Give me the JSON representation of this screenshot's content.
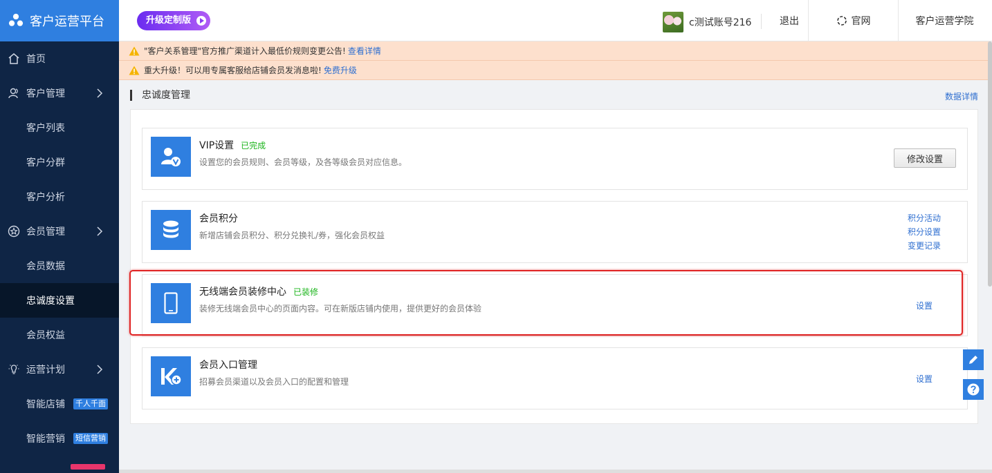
{
  "brand": {
    "title": "客户运营平台"
  },
  "sidebar": {
    "items": [
      {
        "label": "首页",
        "icon": "home-icon",
        "level": "top"
      },
      {
        "label": "客户管理",
        "icon": "users-icon",
        "level": "top",
        "expandable": true
      },
      {
        "label": "客户列表",
        "level": "sub"
      },
      {
        "label": "客户分群",
        "level": "sub"
      },
      {
        "label": "客户分析",
        "level": "sub"
      },
      {
        "label": "会员管理",
        "icon": "star-circle-icon",
        "level": "top",
        "expandable": true
      },
      {
        "label": "会员数据",
        "level": "sub"
      },
      {
        "label": "忠诚度设置",
        "level": "sub",
        "active": true
      },
      {
        "label": "会员权益",
        "level": "sub"
      },
      {
        "label": "运营计划",
        "icon": "bulb-icon",
        "level": "top",
        "expandable": true
      },
      {
        "label": "智能店铺",
        "level": "sub",
        "tag": "千人千面",
        "tag_color": "#2f7fe0"
      },
      {
        "label": "智能营销",
        "level": "sub",
        "tag": "短信营销",
        "tag_color": "#2f7fe0"
      }
    ]
  },
  "header": {
    "upgrade_label": "升级定制版",
    "account_name": "c测试账号216",
    "logout": "退出",
    "official_site": "官网",
    "academy": "客户运营学院"
  },
  "notices": [
    {
      "text": "\"客户关系管理\"官方推广渠道计入最低价规则变更公告!",
      "link": "查看详情"
    },
    {
      "text": "重大升级！可以用专属客服给店铺会员发消息啦!",
      "link": "免费升级"
    }
  ],
  "main": {
    "title": "忠诚度管理",
    "data_detail": "数据详情",
    "cards": [
      {
        "title": "VIP设置",
        "status": "已完成",
        "desc": "设置您的会员规则、会员等级，及各等级会员对应信息。",
        "button": "修改设置"
      },
      {
        "title": "会员积分",
        "status": "",
        "desc": "新增店铺会员积分、积分兑换礼/券，强化会员权益",
        "links": [
          "积分活动",
          "积分设置",
          "变更记录"
        ]
      },
      {
        "title": "无线端会员装修中心",
        "status": "已装修",
        "desc": "装修无线端会员中心的页面内容。可在新版店铺内使用，提供更好的会员体验",
        "links": [
          "设置"
        ]
      },
      {
        "title": "会员入口管理",
        "status": "",
        "desc": "招募会员渠道以及会员入口的配置和管理",
        "links": [
          "设置"
        ]
      }
    ]
  },
  "colors": {
    "sidebar_bg": "#0f2545",
    "brand_blue": "#2f7fe0",
    "success_green": "#1bb41b",
    "highlight_red": "#e02424"
  }
}
